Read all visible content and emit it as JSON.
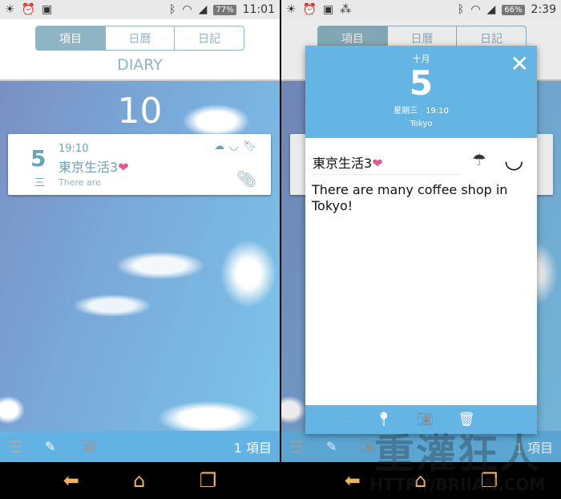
{
  "left": {
    "status": {
      "icons": [
        "brightness-icon",
        "alarm-icon",
        "image-icon"
      ],
      "battery": "77%",
      "time": "11:01"
    },
    "tabs": [
      {
        "label": "項目",
        "active": true
      },
      {
        "label": "日曆",
        "active": false
      },
      {
        "label": "日記",
        "active": false
      }
    ],
    "title": "DIARY",
    "month": "10",
    "entry": {
      "day": "5",
      "weekday": "三",
      "time": "19:10",
      "title": "東京生活3",
      "heart": "❤",
      "preview": "There are"
    },
    "bottom": {
      "count": "1 項目"
    }
  },
  "right": {
    "status": {
      "icons": [
        "brightness-icon",
        "alarm-icon",
        "image-icon",
        "share-icon"
      ],
      "battery": "66%",
      "time": "2:39"
    },
    "tabs": [
      {
        "label": "項目",
        "active": true
      },
      {
        "label": "日曆",
        "active": false
      },
      {
        "label": "日記",
        "active": false
      }
    ],
    "dialog": {
      "month": "十月",
      "day": "5",
      "weekday_time": "星期三　19:10",
      "location": "Tokyo",
      "title": "東京生活3",
      "heart": "❤",
      "body": "There are many coffee shop in Tokyo!",
      "weather": "rain-cloud-icon",
      "mood": "smile-icon"
    },
    "bottom": {
      "count": "1 項目"
    },
    "watermark": {
      "line1": "重灌狂人",
      "line2": "HTTP://BRIIAN.COM"
    }
  },
  "colors": {
    "accent": "#62b3e4",
    "tab": "#8fb5c4",
    "heart": "#e05a8f",
    "nav_icons": "#f0b260"
  }
}
